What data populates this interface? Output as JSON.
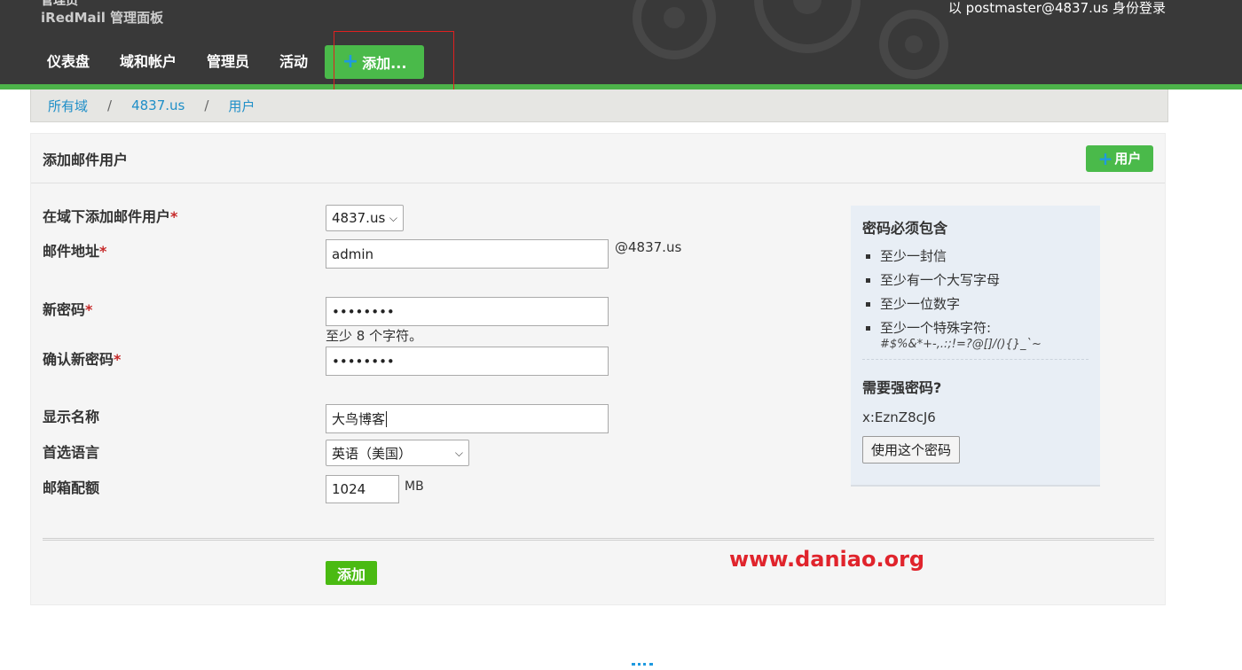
{
  "header": {
    "brand_top": "管理员",
    "brand": "iRedMail 管理面板",
    "login_as": "以 postmaster@4837.us 身份登录",
    "nav": [
      "仪表盘",
      "域和帐户",
      "管理员",
      "活动"
    ],
    "add_label": "添加..."
  },
  "breadcrumb": {
    "items": [
      "所有域",
      "4837.us",
      "用户"
    ],
    "separator": "/"
  },
  "form": {
    "title": "添加邮件用户",
    "user_button": "用户",
    "domain_label": "在域下添加邮件用户",
    "domain_value": "4837.us",
    "email_label": "邮件地址",
    "email_value": "admin",
    "email_suffix": "@4837.us",
    "password_label": "新密码",
    "password_value": "••••••••",
    "password_help": "至少 8 个字符。",
    "confirm_label": "确认新密码",
    "confirm_value": "••••••••",
    "display_label": "显示名称",
    "display_value": "大鸟博客",
    "language_label": "首选语言",
    "language_value": "英语（美国）",
    "quota_label": "邮箱配额",
    "quota_value": "1024",
    "quota_unit": "MB",
    "submit_label": "添加",
    "required_mark": "*"
  },
  "sidebox": {
    "title": "密码必须包含",
    "rules": [
      "至少一封信",
      "至少有一个大写字母",
      "至少一位数字",
      "至少一个特殊字符:"
    ],
    "special_chars": "#$%&*+-,.:;!=?@[]/(){}_`~",
    "strong_title": "需要强密码?",
    "generated_password": "x:EznZ8cJ6",
    "use_button": "使用这个密码"
  },
  "watermark": "www.daniao.org",
  "colors": {
    "accent_green": "#4aba4a",
    "link_blue": "#1f8fc8",
    "header_bg": "#393939",
    "required_red": "#c62828",
    "watermark_red": "#e0242c"
  }
}
